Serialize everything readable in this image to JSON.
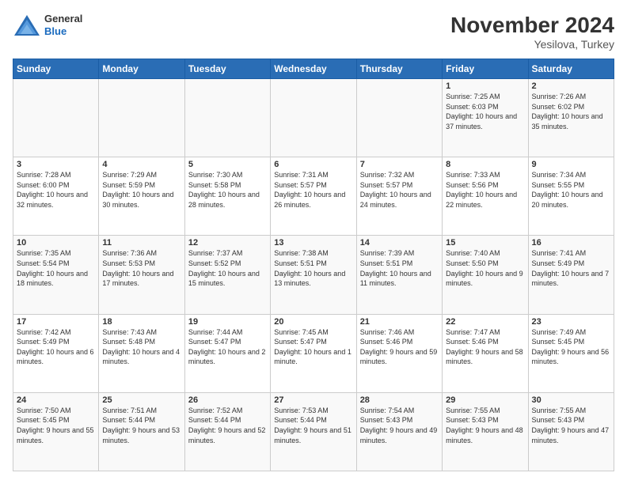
{
  "logo": {
    "general": "General",
    "blue": "Blue"
  },
  "header": {
    "month": "November 2024",
    "location": "Yesilova, Turkey"
  },
  "days_of_week": [
    "Sunday",
    "Monday",
    "Tuesday",
    "Wednesday",
    "Thursday",
    "Friday",
    "Saturday"
  ],
  "weeks": [
    [
      {
        "day": "",
        "info": ""
      },
      {
        "day": "",
        "info": ""
      },
      {
        "day": "",
        "info": ""
      },
      {
        "day": "",
        "info": ""
      },
      {
        "day": "",
        "info": ""
      },
      {
        "day": "1",
        "info": "Sunrise: 7:25 AM\nSunset: 6:03 PM\nDaylight: 10 hours and 37 minutes."
      },
      {
        "day": "2",
        "info": "Sunrise: 7:26 AM\nSunset: 6:02 PM\nDaylight: 10 hours and 35 minutes."
      }
    ],
    [
      {
        "day": "3",
        "info": "Sunrise: 7:28 AM\nSunset: 6:00 PM\nDaylight: 10 hours and 32 minutes."
      },
      {
        "day": "4",
        "info": "Sunrise: 7:29 AM\nSunset: 5:59 PM\nDaylight: 10 hours and 30 minutes."
      },
      {
        "day": "5",
        "info": "Sunrise: 7:30 AM\nSunset: 5:58 PM\nDaylight: 10 hours and 28 minutes."
      },
      {
        "day": "6",
        "info": "Sunrise: 7:31 AM\nSunset: 5:57 PM\nDaylight: 10 hours and 26 minutes."
      },
      {
        "day": "7",
        "info": "Sunrise: 7:32 AM\nSunset: 5:57 PM\nDaylight: 10 hours and 24 minutes."
      },
      {
        "day": "8",
        "info": "Sunrise: 7:33 AM\nSunset: 5:56 PM\nDaylight: 10 hours and 22 minutes."
      },
      {
        "day": "9",
        "info": "Sunrise: 7:34 AM\nSunset: 5:55 PM\nDaylight: 10 hours and 20 minutes."
      }
    ],
    [
      {
        "day": "10",
        "info": "Sunrise: 7:35 AM\nSunset: 5:54 PM\nDaylight: 10 hours and 18 minutes."
      },
      {
        "day": "11",
        "info": "Sunrise: 7:36 AM\nSunset: 5:53 PM\nDaylight: 10 hours and 17 minutes."
      },
      {
        "day": "12",
        "info": "Sunrise: 7:37 AM\nSunset: 5:52 PM\nDaylight: 10 hours and 15 minutes."
      },
      {
        "day": "13",
        "info": "Sunrise: 7:38 AM\nSunset: 5:51 PM\nDaylight: 10 hours and 13 minutes."
      },
      {
        "day": "14",
        "info": "Sunrise: 7:39 AM\nSunset: 5:51 PM\nDaylight: 10 hours and 11 minutes."
      },
      {
        "day": "15",
        "info": "Sunrise: 7:40 AM\nSunset: 5:50 PM\nDaylight: 10 hours and 9 minutes."
      },
      {
        "day": "16",
        "info": "Sunrise: 7:41 AM\nSunset: 5:49 PM\nDaylight: 10 hours and 7 minutes."
      }
    ],
    [
      {
        "day": "17",
        "info": "Sunrise: 7:42 AM\nSunset: 5:49 PM\nDaylight: 10 hours and 6 minutes."
      },
      {
        "day": "18",
        "info": "Sunrise: 7:43 AM\nSunset: 5:48 PM\nDaylight: 10 hours and 4 minutes."
      },
      {
        "day": "19",
        "info": "Sunrise: 7:44 AM\nSunset: 5:47 PM\nDaylight: 10 hours and 2 minutes."
      },
      {
        "day": "20",
        "info": "Sunrise: 7:45 AM\nSunset: 5:47 PM\nDaylight: 10 hours and 1 minute."
      },
      {
        "day": "21",
        "info": "Sunrise: 7:46 AM\nSunset: 5:46 PM\nDaylight: 9 hours and 59 minutes."
      },
      {
        "day": "22",
        "info": "Sunrise: 7:47 AM\nSunset: 5:46 PM\nDaylight: 9 hours and 58 minutes."
      },
      {
        "day": "23",
        "info": "Sunrise: 7:49 AM\nSunset: 5:45 PM\nDaylight: 9 hours and 56 minutes."
      }
    ],
    [
      {
        "day": "24",
        "info": "Sunrise: 7:50 AM\nSunset: 5:45 PM\nDaylight: 9 hours and 55 minutes."
      },
      {
        "day": "25",
        "info": "Sunrise: 7:51 AM\nSunset: 5:44 PM\nDaylight: 9 hours and 53 minutes."
      },
      {
        "day": "26",
        "info": "Sunrise: 7:52 AM\nSunset: 5:44 PM\nDaylight: 9 hours and 52 minutes."
      },
      {
        "day": "27",
        "info": "Sunrise: 7:53 AM\nSunset: 5:44 PM\nDaylight: 9 hours and 51 minutes."
      },
      {
        "day": "28",
        "info": "Sunrise: 7:54 AM\nSunset: 5:43 PM\nDaylight: 9 hours and 49 minutes."
      },
      {
        "day": "29",
        "info": "Sunrise: 7:55 AM\nSunset: 5:43 PM\nDaylight: 9 hours and 48 minutes."
      },
      {
        "day": "30",
        "info": "Sunrise: 7:55 AM\nSunset: 5:43 PM\nDaylight: 9 hours and 47 minutes."
      }
    ]
  ]
}
